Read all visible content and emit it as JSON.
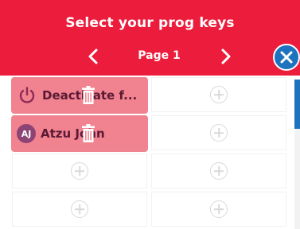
{
  "header": {
    "title": "Select your prog keys",
    "page_label": "Page 1",
    "prev_icon": "chevron-left-icon",
    "next_icon": "chevron-right-icon",
    "close_icon": "close-icon"
  },
  "keys": [
    {
      "label": "Deactivate f...",
      "icon": "power-icon",
      "action_icon": "trash-icon"
    },
    {
      "label": "Atzu John",
      "avatar_initials": "AJ",
      "action_icon": "trash-icon"
    }
  ],
  "empty_slot_icon": "plus-circle-icon",
  "colors": {
    "header_bg": "#ec1c3c",
    "assigned_key_bg": "#f1828f",
    "assigned_key_text": "#5a1a35",
    "close_button_bg": "#1e73be",
    "avatar_bg": "#8c4475",
    "scroll_thumb": "#1e73be"
  }
}
